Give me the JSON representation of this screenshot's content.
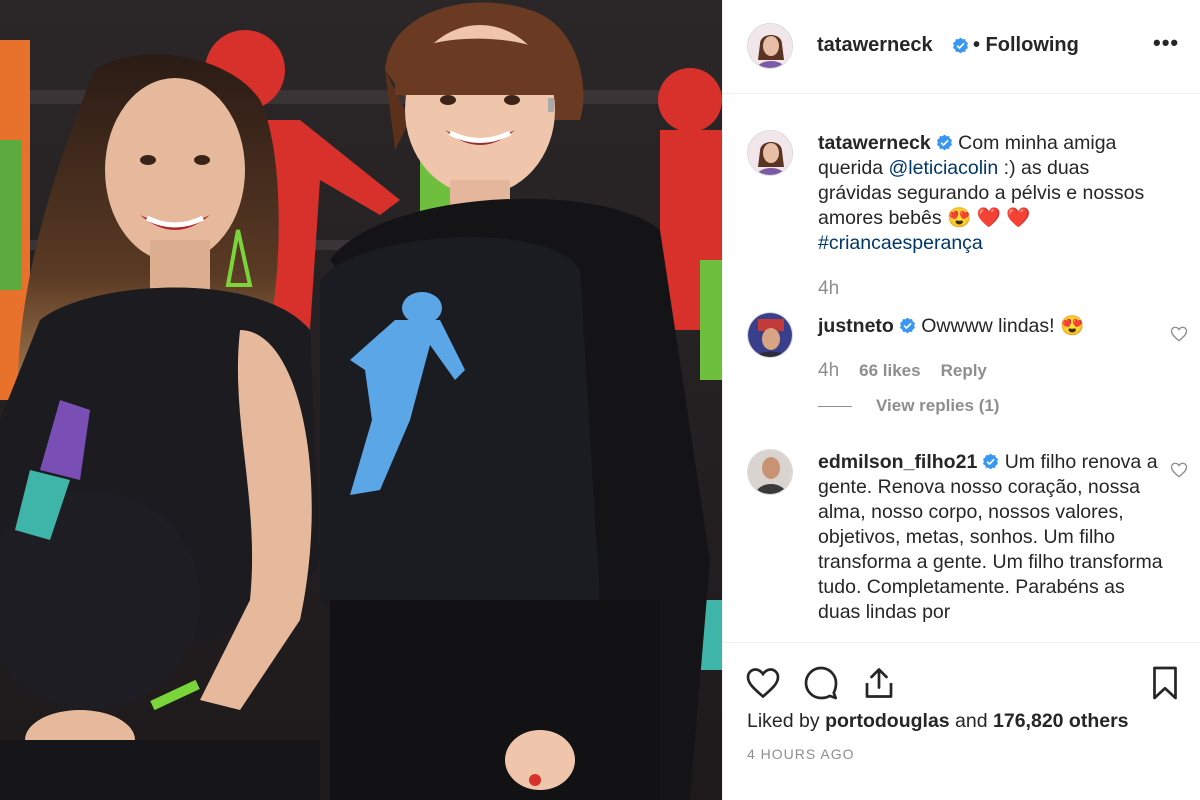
{
  "post": {
    "author": "tatawerneck",
    "follow_status": "• Following",
    "more_label": "•••"
  },
  "caption": {
    "username": "tatawerneck",
    "text_before": "Com minha amiga querida ",
    "mention": "@leticiacolin",
    "text_after": " :) as duas grávidas segurando a pélvis e nossos amores bebês 😍 ❤️ ❤️",
    "hashtag": "#criancaesperança",
    "time": "4h"
  },
  "comments": [
    {
      "username": "justneto",
      "text": "Owwww lindas! 😍",
      "time": "4h",
      "likes": "66 likes",
      "reply": "Reply",
      "view_replies": "View replies (1)"
    },
    {
      "username": "edmilson_filho21",
      "text": "Um filho renova a gente. Renova nosso coração, nossa alma, nosso corpo, nossos valores, objetivos, metas, sonhos. Um filho transforma a gente. Um filho transforma tudo. Completamente. Parabéns as duas lindas por"
    }
  ],
  "footer": {
    "liked_by_prefix": "Liked by ",
    "liked_by_user": "portodouglas",
    "liked_by_mid": " and ",
    "liked_by_count": "176,820 others",
    "time_ago": "4 HOURS AGO"
  },
  "icons": {
    "verified": "verified-badge-icon",
    "like": "heart-icon",
    "comment": "comment-icon",
    "share": "share-icon",
    "save": "bookmark-icon",
    "comment_like": "small-heart-icon",
    "more": "more-options-icon"
  },
  "colors": {
    "verified_blue": "#3897f0",
    "link_blue": "#00376b",
    "muted_gray": "#8e8e8e",
    "text": "#262626"
  }
}
